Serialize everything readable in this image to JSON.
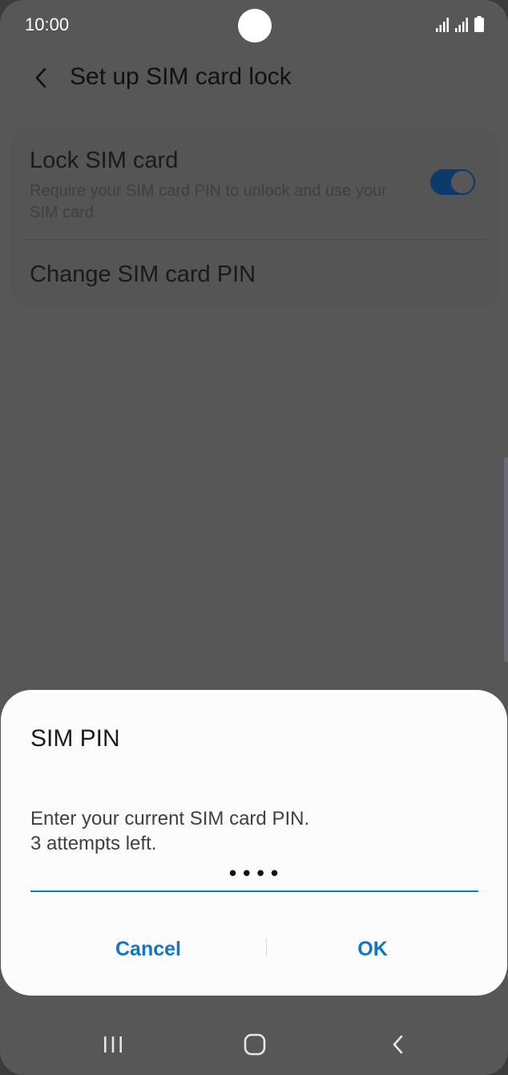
{
  "status_bar": {
    "time": "10:00",
    "icons": [
      "signal-sim1-icon",
      "signal-sim2-icon",
      "battery-icon"
    ]
  },
  "header": {
    "back_icon": "chevron-left-icon",
    "title": "Set up SIM card lock"
  },
  "settings": {
    "lock_sim": {
      "title": "Lock SIM card",
      "description": "Require your SIM card PIN to unlock and use your SIM card.",
      "toggle_on": true
    },
    "change_pin": {
      "title": "Change SIM card PIN"
    }
  },
  "dialog": {
    "title": "SIM PIN",
    "message_line1": "Enter your current SIM card PIN.",
    "message_line2": "3 attempts left.",
    "pin_value": "••••",
    "cancel_label": "Cancel",
    "ok_label": "OK"
  },
  "nav_bar": {
    "items": [
      "recents-icon",
      "home-icon",
      "back-icon"
    ]
  },
  "colors": {
    "accent": "#1175c2",
    "input_underline": "#0a7fd1",
    "toggle": "#0c3a6a",
    "scrim_background": "#575757",
    "dialog_background": "#fcfcfc"
  }
}
